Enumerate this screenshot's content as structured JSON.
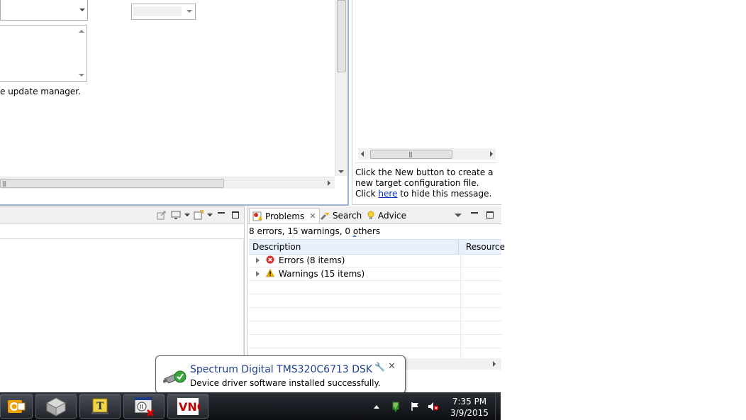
{
  "editor": {
    "message": "e update manager."
  },
  "target_panel": {
    "help_prefix": "Click the New button to create a new target configuration file. Click ",
    "help_link": "here",
    "help_suffix": " to hide this message."
  },
  "problems": {
    "tabs": [
      {
        "label": "Problems",
        "icon": "problems-icon"
      },
      {
        "label": "Search",
        "icon": "search-flashlight-icon"
      },
      {
        "label": "Advice",
        "icon": "lightbulb-icon"
      }
    ],
    "summary": "8 errors, 15 warnings, 0 others",
    "columns": [
      "Description",
      "Resource"
    ],
    "rows": [
      {
        "label": "Errors (8 items)",
        "icon": "error-icon"
      },
      {
        "label": "Warnings (15 items)",
        "icon": "warning-icon"
      }
    ]
  },
  "balloon": {
    "title": "Spectrum Digital TMS320C6713 DSK",
    "body": "Device driver software installed successfully."
  },
  "taskbar": {
    "apps": [
      "outlook-icon",
      "cube-app-icon",
      "ti-tool-icon",
      "dsk-app-icon",
      "vnc-icon"
    ],
    "vnc_label": "VNC",
    "time": "7:35 PM",
    "date": "3/9/2015"
  },
  "colors": {
    "accent": "#3a7fcf",
    "link": "#0033cc",
    "error": "#d93025",
    "warning": "#f2b300",
    "balloon_title": "#1f3f8f"
  }
}
